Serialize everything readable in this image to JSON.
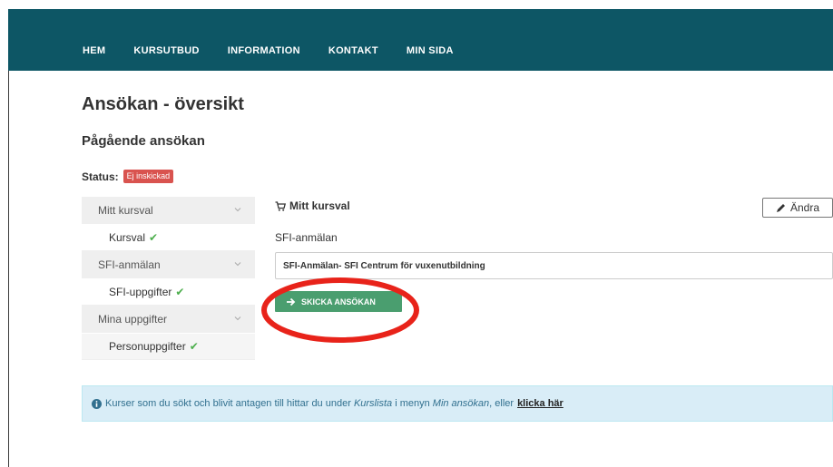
{
  "nav": {
    "items": [
      "HEM",
      "KURSUTBUD",
      "INFORMATION",
      "KONTAKT",
      "MIN SIDA"
    ]
  },
  "page": {
    "title": "Ansökan - översikt",
    "subtitle": "Pågående ansökan"
  },
  "status": {
    "label": "Status:",
    "badge": "Ej inskickad",
    "badge_color": "#d9534f"
  },
  "sidebar": {
    "groups": [
      {
        "label": "Mitt kursval",
        "sub": "Kursval"
      },
      {
        "label": "SFI-anmälan",
        "sub": "SFI-uppgifter"
      },
      {
        "label": "Mina uppgifter",
        "sub": "Personuppgifter"
      }
    ]
  },
  "main": {
    "heading": "Mitt kursval",
    "edit_label": "Ändra",
    "field_label": "SFI-anmälan",
    "field_value": "SFI-Anmälan- SFI Centrum för vuxenutbildning",
    "send_label": "SKICKA ANSÖKAN",
    "send_color": "#4a9e6f"
  },
  "info": {
    "part1": "Kurser som du sökt och blivit antagen till hittar du under",
    "em1": "Kurslista",
    "part2": "i menyn",
    "em2": "Min ansökan",
    "part3": ", eller",
    "link": "klicka här"
  },
  "colors": {
    "nav_bg": "#0d5665",
    "annotation_circle": "#e8231a"
  }
}
